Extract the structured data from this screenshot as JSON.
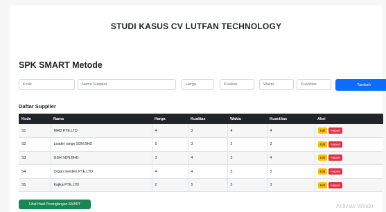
{
  "page_title": "STUDI KASUS CV LUTFAN TECHNOLOGY",
  "section_title": "SPK SMART Metode",
  "form": {
    "kode_placeholder": "Kode",
    "nama_placeholder": "Nama Supplier",
    "harga_placeholder": "Harga",
    "kualitas_placeholder": "Kualitas",
    "waktu_placeholder": "Waktu",
    "kuantitas_placeholder": "Kuantitas",
    "tambah_label": "Tambah"
  },
  "table_title": "Daftar Supplier",
  "table": {
    "headers": [
      "Kode",
      "Nama",
      "Harga",
      "Kualitas",
      "Waktu",
      "Kuantitas",
      "Aksi"
    ],
    "rows": [
      [
        "S1",
        "MHD PTE.LTD",
        "4",
        "3",
        "4",
        "4"
      ],
      [
        "S2",
        "Leader range SDN.BHD",
        "5",
        "3",
        "2",
        "3"
      ],
      [
        "S3",
        "GSH SDN.BHD",
        "3",
        "4",
        "3",
        "4"
      ],
      [
        "S4",
        "Organ needles PTE.LTD",
        "4",
        "4",
        "5",
        "5"
      ],
      [
        "S5",
        "Kajika PTE.LTD",
        "2",
        "5",
        "3",
        "3"
      ]
    ],
    "edit_label": "Edit",
    "hapus_label": "Hapus"
  },
  "hasil_button_label": "Lihat Hasil Perangkingan SMART",
  "watermark": "Activate Windo",
  "colors": {
    "primary": "#0d6efd",
    "success": "#198754",
    "warning": "#ffc107",
    "danger": "#dc3545",
    "table_header": "#212529"
  }
}
